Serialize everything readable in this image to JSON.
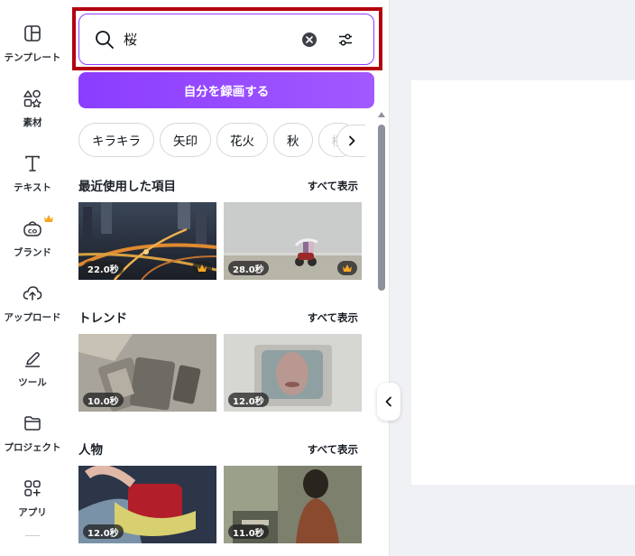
{
  "rail": {
    "items": [
      {
        "label": "テンプレート",
        "icon": "template-icon"
      },
      {
        "label": "素材",
        "icon": "elements-icon"
      },
      {
        "label": "テキスト",
        "icon": "text-icon"
      },
      {
        "label": "ブランド",
        "icon": "brand-icon"
      },
      {
        "label": "アップロード",
        "icon": "upload-icon"
      },
      {
        "label": "ツール",
        "icon": "tools-icon"
      },
      {
        "label": "プロジェクト",
        "icon": "folder-icon"
      },
      {
        "label": "アプリ",
        "icon": "apps-icon"
      }
    ]
  },
  "search": {
    "value": "桜"
  },
  "record_button": "自分を録画する",
  "chips": [
    "キラキラ",
    "矢印",
    "花火",
    "秋",
    "桜"
  ],
  "sections": {
    "recent": {
      "title": "最近使用した項目",
      "see_all": "すべて表示",
      "items": [
        {
          "duration": "22.0秒",
          "premium": true
        },
        {
          "duration": "28.0秒",
          "premium": true
        }
      ]
    },
    "trend": {
      "title": "トレンド",
      "see_all": "すべて表示",
      "items": [
        {
          "duration": "10.0秒"
        },
        {
          "duration": "12.0秒"
        }
      ]
    },
    "people": {
      "title": "人物",
      "see_all": "すべて表示",
      "items": [
        {
          "duration": "12.0秒"
        },
        {
          "duration": "11.0秒"
        }
      ]
    }
  },
  "colors": {
    "accent": "#8b3dff",
    "highlight": "#b3000f",
    "premium": "#f5a623"
  }
}
